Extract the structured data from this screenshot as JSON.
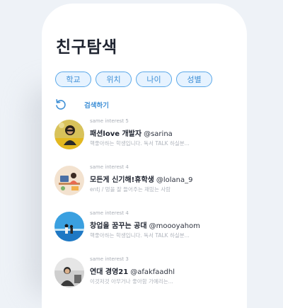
{
  "page": {
    "title": "친구탐색",
    "filters": [
      {
        "label": "학교"
      },
      {
        "label": "위치"
      },
      {
        "label": "나이"
      },
      {
        "label": "성별"
      }
    ],
    "refresh_label": "검색하기",
    "friends": [
      {
        "interest": "same interest 5",
        "name": "패션love 개발자",
        "handle": "@sarina",
        "bio": "핵좋아하는 학생입니다. 독서 TALK 하실분..."
      },
      {
        "interest": "same interest 4",
        "name": "모든게 신기해!휴학생",
        "handle": "@lolana_9",
        "bio": "entj / 멍을 잘 들어주는 재밌는 사람"
      },
      {
        "interest": "same interest 4",
        "name": "창업을 꿈꾸는 공대",
        "handle": "@moooyahom",
        "bio": "핵좋아하는 학생입니다. 독서 TALK 하실분..."
      },
      {
        "interest": "same interest 3",
        "name": "연대 경영21",
        "handle": "@afakfaadhl",
        "bio": "이것저것 아무거나 좋아함 가예리는..."
      }
    ]
  },
  "colors": {
    "accent": "#3e8fd6",
    "chip_bg": "#e7f3ff",
    "chip_border": "#5aa8e8",
    "title": "#1f2430",
    "muted": "#a9aeb6"
  }
}
